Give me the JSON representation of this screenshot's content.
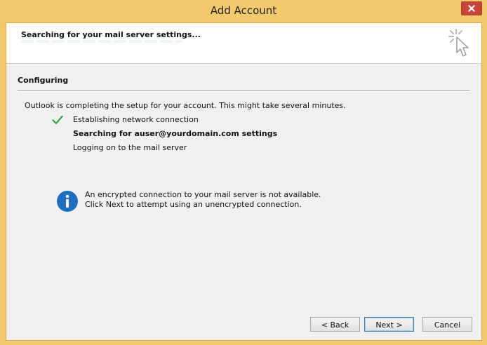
{
  "window": {
    "title": "Add Account"
  },
  "header": {
    "title": "Searching for your mail server settings..."
  },
  "section": {
    "title": "Configuring"
  },
  "intro": "Outlook is completing the setup for your account. This might take several minutes.",
  "steps": [
    {
      "label": "Establishing network connection",
      "status": "done"
    },
    {
      "label": "Searching for auser@yourdomain.com settings",
      "status": "in-progress"
    },
    {
      "label": "Logging on to the mail server",
      "status": "pending"
    }
  ],
  "notice": {
    "line1": "An encrypted connection to your mail server is not available.",
    "line2": "Click Next to attempt using an unencrypted connection."
  },
  "buttons": {
    "back": "< Back",
    "next": "Next >",
    "cancel": "Cancel"
  },
  "colors": {
    "frame": "#f3c96d",
    "check": "#3aa036",
    "info": "#1f6fbf",
    "close": "#c7453a"
  }
}
